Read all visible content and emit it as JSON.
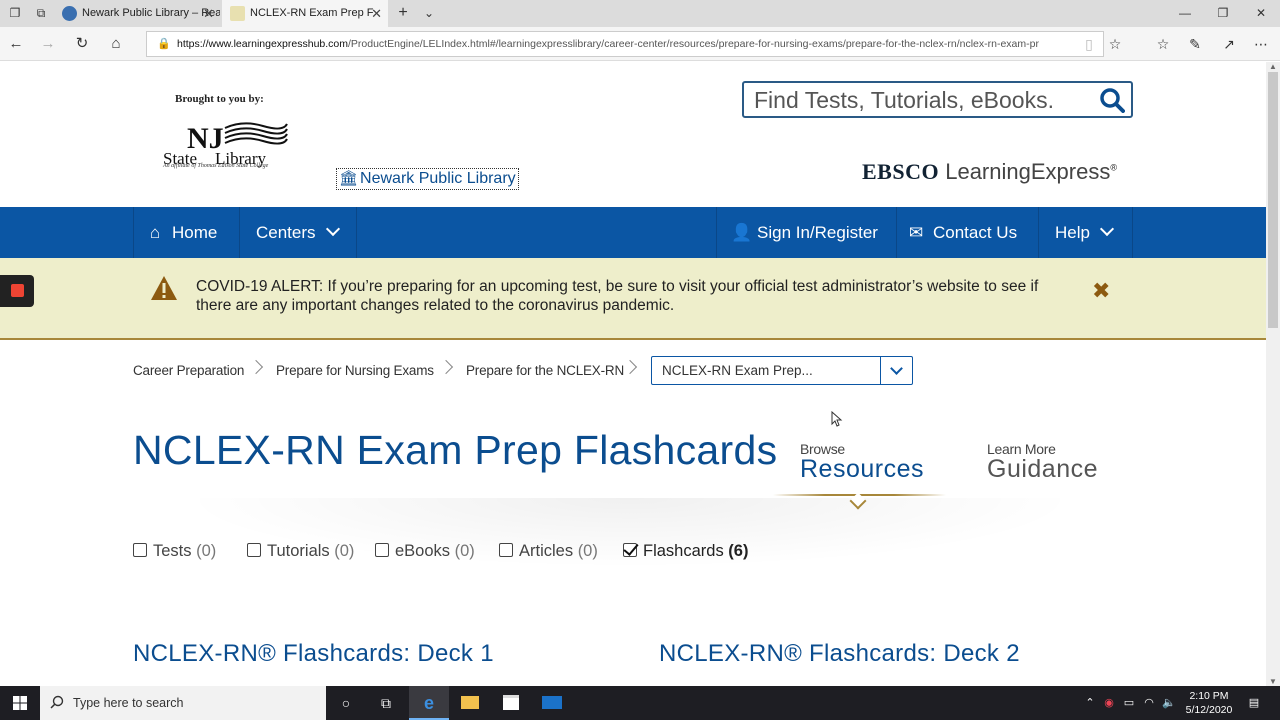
{
  "browser": {
    "tabs": [
      {
        "label": "Newark Public Library – Rea"
      },
      {
        "label": "NCLEX-RN Exam Prep F"
      }
    ],
    "url_host": "https://www.learningexpresshub.com",
    "url_path": "/ProductEngine/LELIndex.html#/learningexpresslibrary/career-center/resources/prepare-for-nursing-exams/prepare-for-the-nclex-rn/nclex-rn-exam-pr"
  },
  "header": {
    "brought_by": "Brought to you by:",
    "nj_logo_text": "NJ State Library",
    "nj_sub": "An affiliate of Thomas Edison State College",
    "library_link": "Newark Public Library",
    "search_placeholder": "Find Tests, Tutorials, eBooks.",
    "brand_bold": "EBSCO",
    "brand_light": "LearningExpress",
    "brand_reg": "®"
  },
  "nav": {
    "home": "Home",
    "centers": "Centers",
    "signin": "Sign In/Register",
    "contact": "Contact Us",
    "help": "Help"
  },
  "alert": {
    "message": "COVID-19 ALERT: If you’re preparing for an upcoming test, be sure to visit your official test administrator’s website to see if there are any important changes related to the coronavirus pandemic."
  },
  "breadcrumb": {
    "items": [
      "Career Preparation",
      "Prepare for Nursing Exams",
      "Prepare for the NCLEX-RN"
    ],
    "selected": "NCLEX-RN Exam Prep..."
  },
  "main": {
    "title": "NCLEX-RN Exam Prep Flashcards",
    "browse_small": "Browse",
    "browse_big": "Resources",
    "guide_small": "Learn More",
    "guide_big": "Guidance",
    "filters": [
      {
        "label": "Tests",
        "count": "(0)",
        "checked": false
      },
      {
        "label": "Tutorials",
        "count": "(0)",
        "checked": false
      },
      {
        "label": "eBooks",
        "count": "(0)",
        "checked": false
      },
      {
        "label": "Articles",
        "count": "(0)",
        "checked": false
      },
      {
        "label": "Flashcards",
        "count": "(6)",
        "checked": true
      }
    ],
    "decks": [
      "NCLEX-RN® Flashcards: Deck 1",
      "NCLEX-RN® Flashcards: Deck 2"
    ]
  },
  "taskbar": {
    "search_placeholder": "Type here to search",
    "time": "2:10 PM",
    "date": "5/12/2020"
  },
  "colors": {
    "nav_blue": "#0b56a4",
    "title_blue": "#0b4d8f",
    "alert_bg": "#eeeecb",
    "gold": "#a7873a"
  }
}
